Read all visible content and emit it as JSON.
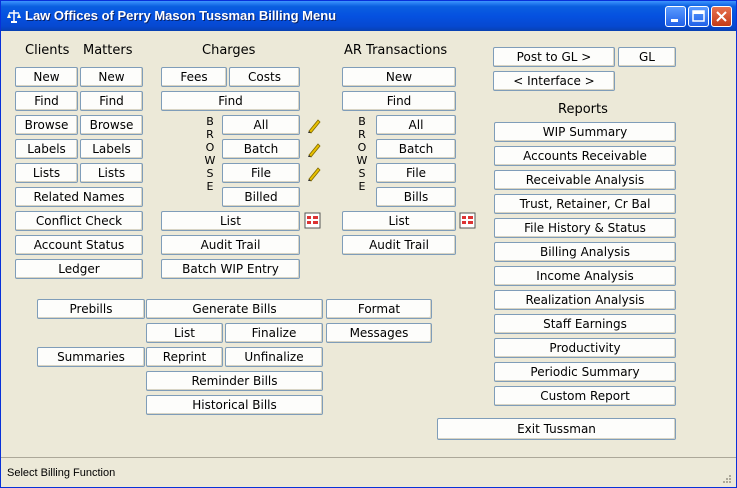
{
  "window": {
    "title": "Law Offices of Perry Mason  Tussman Billing Menu"
  },
  "clients": {
    "header_clients": "Clients",
    "header_matters": "Matters",
    "new": "New",
    "find": "Find",
    "browse": "Browse",
    "labels": "Labels",
    "lists": "Lists",
    "related_names": "Related Names",
    "conflict_check": "Conflict Check",
    "account_status": "Account Status",
    "ledger": "Ledger"
  },
  "charges": {
    "header": "Charges",
    "fees": "Fees",
    "costs": "Costs",
    "find": "Find",
    "browse_letters": [
      "B",
      "R",
      "O",
      "W",
      "S",
      "E"
    ],
    "all": "All",
    "batch": "Batch",
    "file": "File",
    "billed": "Billed",
    "list": "List",
    "audit_trail": "Audit Trail",
    "batch_wip": "Batch WIP Entry"
  },
  "ar": {
    "header": "AR Transactions",
    "new": "New",
    "find": "Find",
    "browse_letters": [
      "B",
      "R",
      "O",
      "W",
      "S",
      "E"
    ],
    "all": "All",
    "batch": "Batch",
    "file": "File",
    "bills": "Bills",
    "list": "List",
    "audit_trail": "Audit Trail"
  },
  "gl": {
    "post": "Post to GL >",
    "gl": "GL",
    "interface": "< Interface >"
  },
  "reports": {
    "header": "Reports",
    "items": [
      "WIP Summary",
      "Accounts Receivable",
      "Receivable Analysis",
      "Trust, Retainer, Cr Bal",
      "File History & Status",
      "Billing Analysis",
      "Income Analysis",
      "Realization Analysis",
      "Staff Earnings",
      "Productivity",
      "Periodic Summary",
      "Custom Report"
    ]
  },
  "billing": {
    "prebills": "Prebills",
    "generate": "Generate Bills",
    "format": "Format",
    "list": "List",
    "finalize": "Finalize",
    "messages": "Messages",
    "summaries": "Summaries",
    "reprint": "Reprint",
    "unfinalize": "Unfinalize",
    "reminder": "Reminder Bills",
    "historical": "Historical Bills"
  },
  "exit": "Exit Tussman",
  "status": {
    "text": "Select Billing Function"
  },
  "colors": {
    "title_blue": "#0551e0",
    "face": "#ece9d8",
    "button_border": "#7f9db9"
  }
}
